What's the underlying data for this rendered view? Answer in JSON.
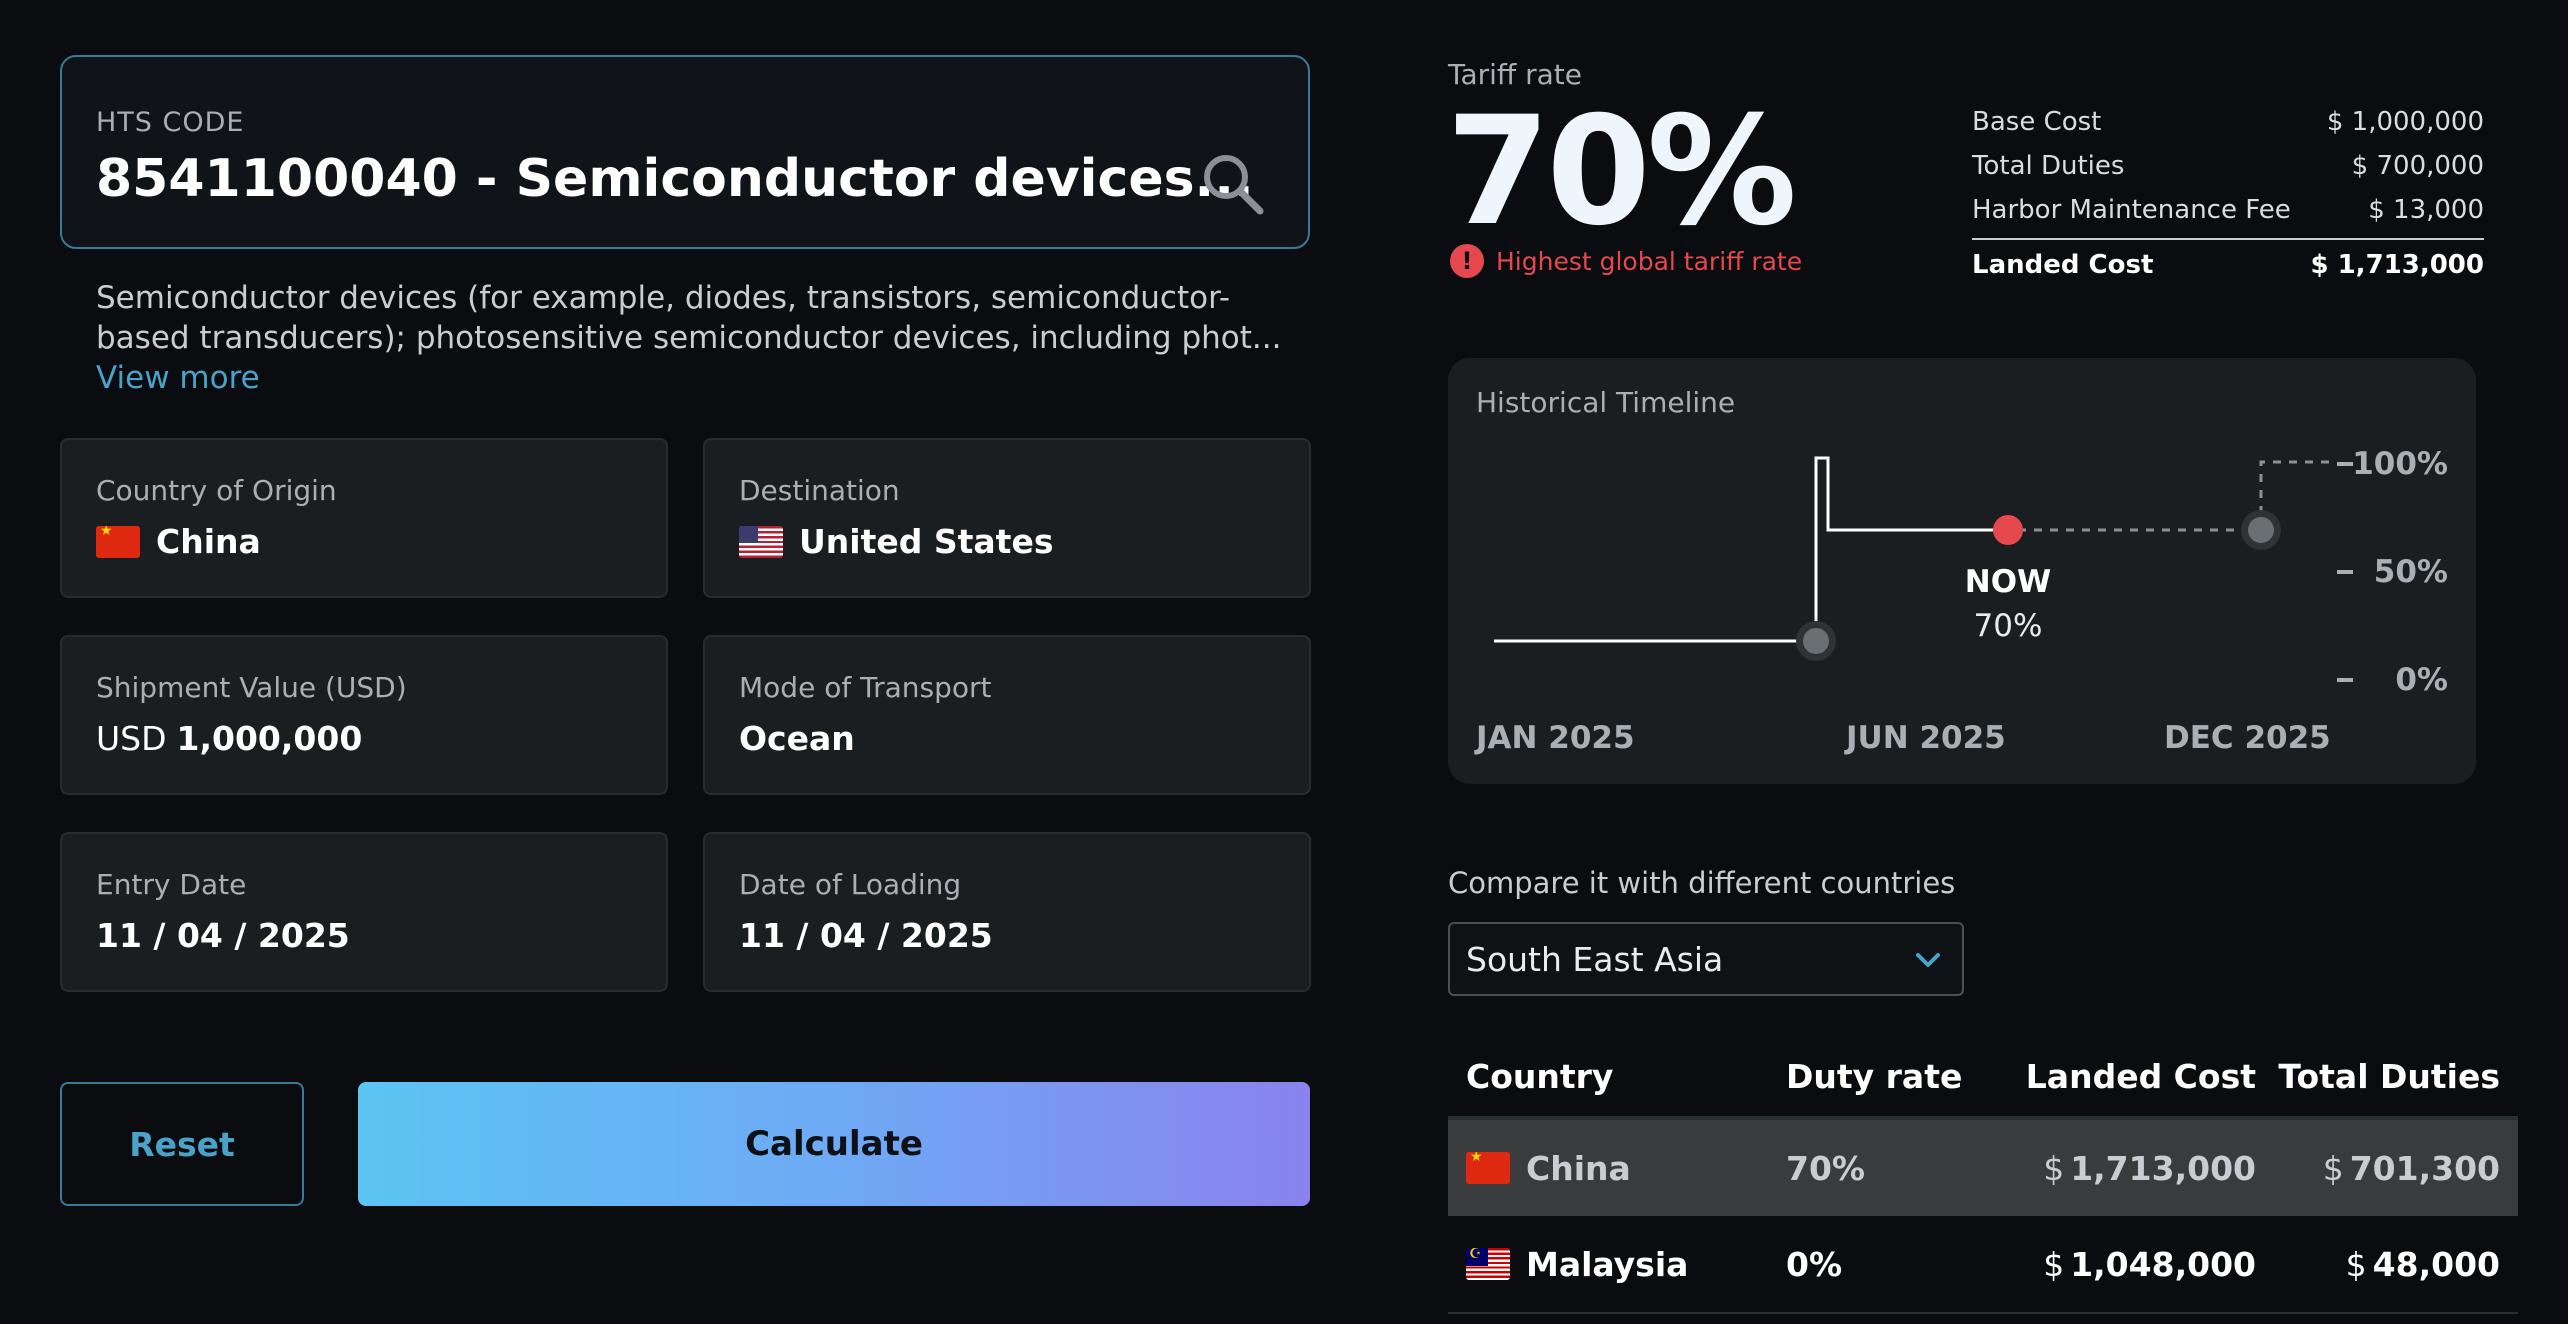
{
  "hts": {
    "label": "HTS CODE",
    "value": "8541100040 - Semiconductor devices...",
    "description": "Semiconductor devices (for example, diodes, transistors, semiconductor-based transducers); photosensitive semiconductor devices, including phot...",
    "view_more": "View more"
  },
  "fields": {
    "origin": {
      "label": "Country of Origin",
      "value": "China",
      "flag": "cn-flag-icon"
    },
    "destination": {
      "label": "Destination",
      "value": "United States",
      "flag": "us-flag-icon"
    },
    "shipment": {
      "label": "Shipment Value (USD)",
      "currency": "USD",
      "value": "1,000,000"
    },
    "transport": {
      "label": "Mode of Transport",
      "value": "Ocean"
    },
    "entry_date": {
      "label": "Entry Date",
      "value": "11 / 04 / 2025"
    },
    "loading_date": {
      "label": "Date of Loading",
      "value": "11 / 04 / 2025"
    }
  },
  "buttons": {
    "reset": "Reset",
    "calculate": "Calculate"
  },
  "tariff": {
    "label": "Tariff rate",
    "value": "70%",
    "warning": "Highest global tariff rate"
  },
  "costs": [
    {
      "label": "Base Cost",
      "value": "$ 1,000,000"
    },
    {
      "label": "Total Duties",
      "value": "$ 700,000"
    },
    {
      "label": "Harbor Maintenance Fee",
      "value": "$ 13,000"
    }
  ],
  "landed": {
    "label": "Landed Cost",
    "value": "$ 1,713,000"
  },
  "timeline": {
    "title": "Historical Timeline",
    "now_label": "NOW",
    "now_value": "70%",
    "y_ticks": [
      "100%",
      "50%",
      "0%"
    ],
    "x_ticks": [
      "JAN 2025",
      "JUN 2025",
      "DEC 2025"
    ]
  },
  "compare": {
    "label": "Compare it with different countries",
    "region": "South East Asia",
    "headers": [
      "Country",
      "Duty rate",
      "Landed Cost",
      "Total Duties"
    ],
    "rows": [
      {
        "country": "China",
        "rate": "70%",
        "landed": "1,713,000",
        "duties": "701,300"
      },
      {
        "country": "Malaysia",
        "rate": "0%",
        "landed": "1,048,000",
        "duties": "48,000"
      }
    ],
    "currency_symbol": "$"
  },
  "colors": {
    "accent": "#4aa2c8",
    "warning": "#e5484d",
    "panel": "#1a1e21"
  }
}
